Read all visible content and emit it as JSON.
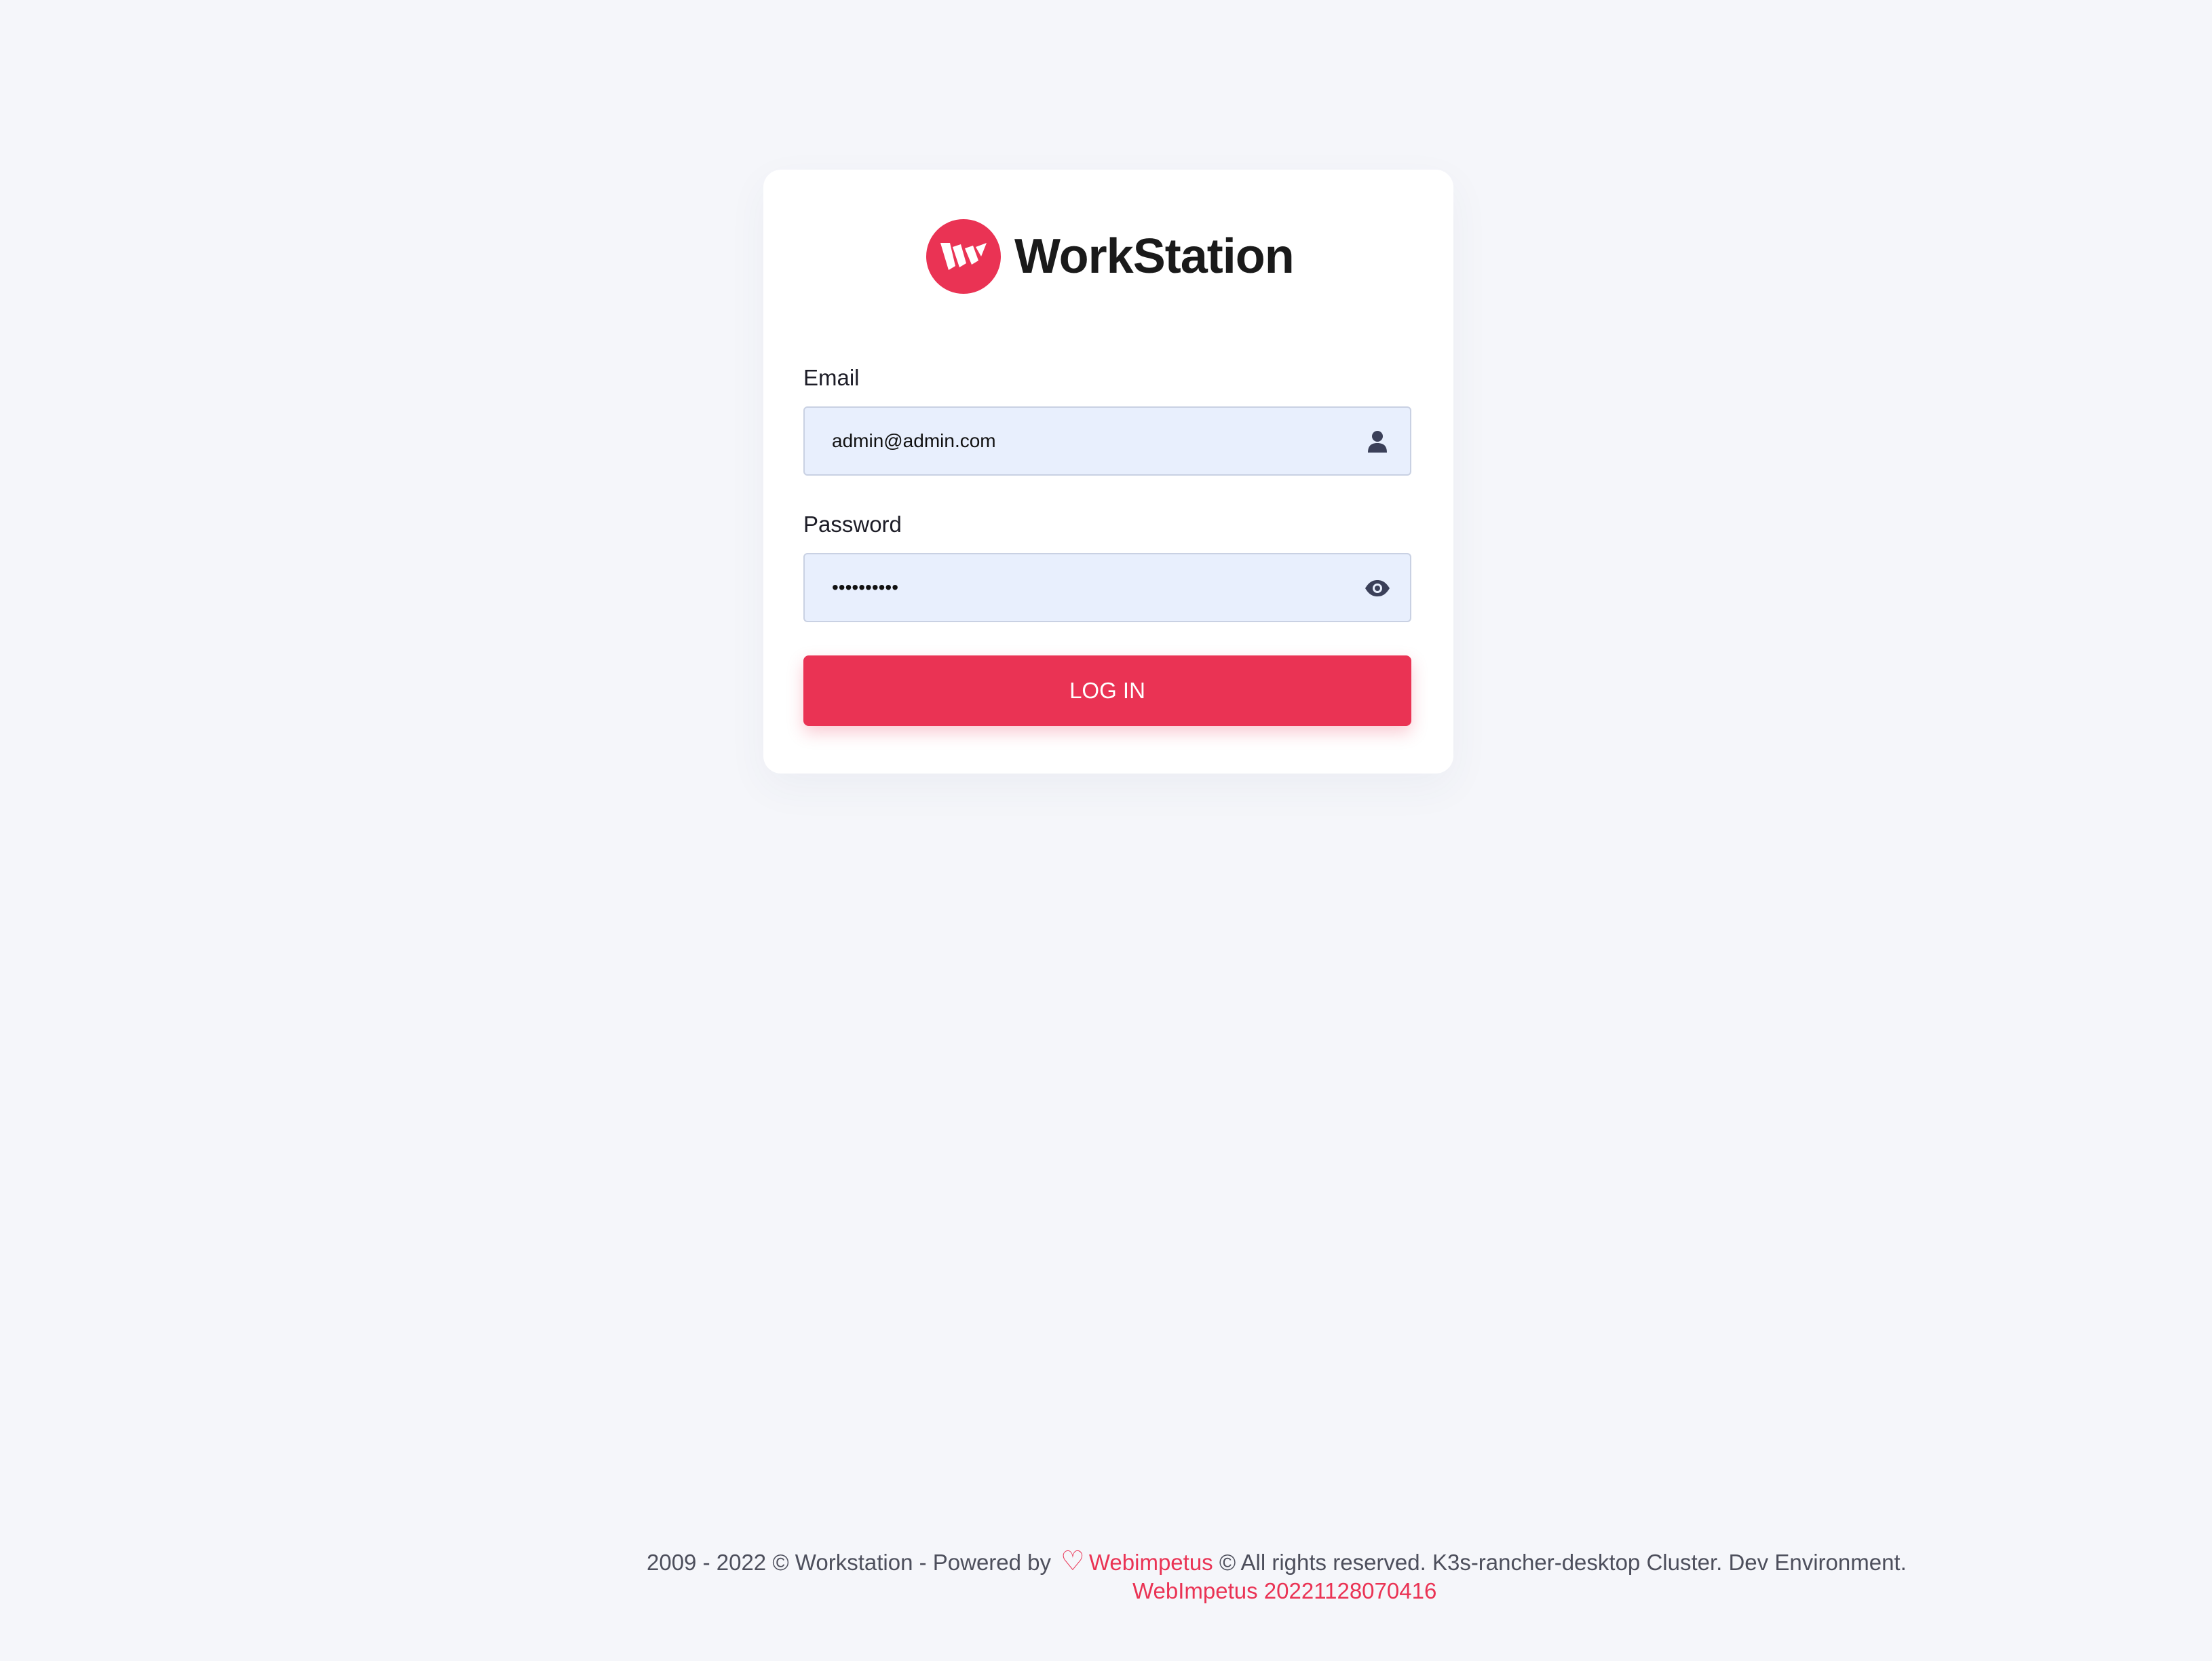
{
  "brand": {
    "name": "WorkStation",
    "color": "#ea3354"
  },
  "form": {
    "email": {
      "label": "Email",
      "value": "admin@admin.com",
      "icon": "user-icon"
    },
    "password": {
      "label": "Password",
      "value": "••••••••••",
      "icon": "eye-icon"
    },
    "submit_label": "LOG IN"
  },
  "footer": {
    "copyright": "2009 - 2022 © Workstation - Powered by",
    "heart": "♡",
    "company_link": "Webimpetus",
    "rights": "© All rights reserved. K3s-rancher-desktop Cluster. Dev Environment.",
    "version": "WebImpetus 20221128070416"
  }
}
